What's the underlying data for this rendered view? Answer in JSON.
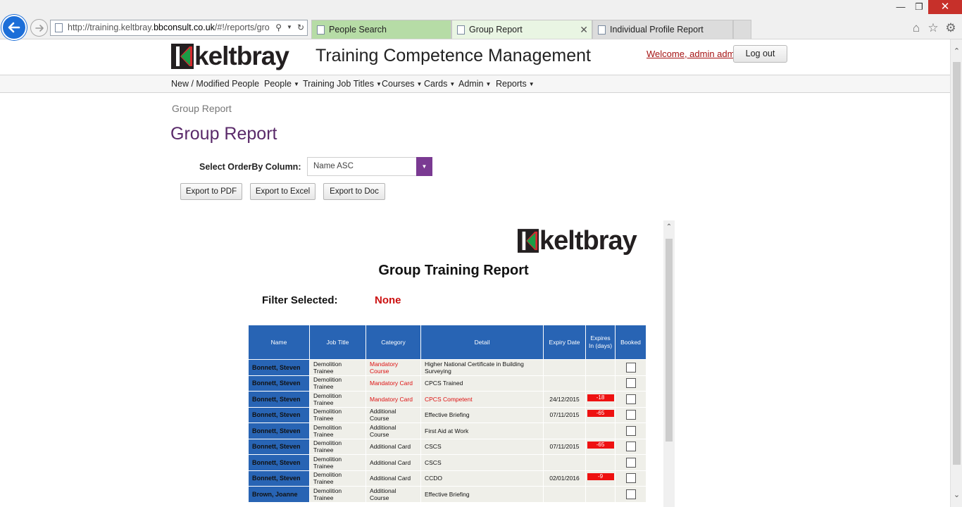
{
  "browser": {
    "url_prefix": "http://training.keltbray.",
    "url_domain": "bbconsult.co.uk",
    "url_suffix": "/#!/reports/gro",
    "tabs": [
      {
        "label": "People Search"
      },
      {
        "label": "Group Report"
      },
      {
        "label": "Individual Profile Report"
      }
    ]
  },
  "header": {
    "logo_text": "keltbray",
    "app_title": "Training Competence Management",
    "welcome": "Welcome, admin admin",
    "logout_label": "Log out"
  },
  "nav": [
    {
      "label": "New / Modified People",
      "dropdown": false
    },
    {
      "label": "People",
      "dropdown": true
    },
    {
      "label": "Training Job Titles",
      "dropdown": true
    },
    {
      "label": "Courses",
      "dropdown": true
    },
    {
      "label": "Cards",
      "dropdown": true
    },
    {
      "label": "Admin",
      "dropdown": true
    },
    {
      "label": "Reports",
      "dropdown": true
    }
  ],
  "breadcrumb": "Group Report",
  "page_title": "Group Report",
  "order_by": {
    "label": "Select OrderBy Column:",
    "value": "Name ASC"
  },
  "exports": {
    "pdf": "Export to PDF",
    "excel": "Export to Excel",
    "doc": "Export to Doc"
  },
  "colors": {
    "accent": "#7a3a92",
    "table_header": "#2864b4",
    "alert_red": "#ee1111"
  },
  "report": {
    "logo_text": "keltbray",
    "title": "Group Training Report",
    "filter_label": "Filter Selected:",
    "filter_value": "None",
    "columns": [
      "Name",
      "Job Title",
      "Category",
      "Detail",
      "Expiry Date",
      "Expires In (days)",
      "Booked"
    ],
    "rows": [
      {
        "name": "Bonnett, Steven",
        "job": "Demolition Trainee",
        "category": "Mandatory Course",
        "category_red": true,
        "detail": "Higher National Certificate in Building Surveying",
        "detail_red": false,
        "expiry": "",
        "expires_in": "",
        "booked": false
      },
      {
        "name": "Bonnett, Steven",
        "job": "Demolition Trainee",
        "category": "Mandatory Card",
        "category_red": true,
        "detail": "CPCS Trained",
        "detail_red": false,
        "expiry": "",
        "expires_in": "",
        "booked": false
      },
      {
        "name": "Bonnett, Steven",
        "job": "Demolition Trainee",
        "category": "Mandatory Card",
        "category_red": true,
        "detail": "CPCS Competent",
        "detail_red": true,
        "expiry": "24/12/2015",
        "expires_in": "-18",
        "booked": false
      },
      {
        "name": "Bonnett, Steven",
        "job": "Demolition Trainee",
        "category": "Additional Course",
        "category_red": false,
        "detail": "Effective Briefing",
        "detail_red": false,
        "expiry": "07/11/2015",
        "expires_in": "-65",
        "booked": false
      },
      {
        "name": "Bonnett, Steven",
        "job": "Demolition Trainee",
        "category": "Additional Course",
        "category_red": false,
        "detail": "First Aid at Work",
        "detail_red": false,
        "expiry": "",
        "expires_in": "",
        "booked": false
      },
      {
        "name": "Bonnett, Steven",
        "job": "Demolition Trainee",
        "category": "Additional Card",
        "category_red": false,
        "detail": "CSCS",
        "detail_red": false,
        "expiry": "07/11/2015",
        "expires_in": "-65",
        "booked": false
      },
      {
        "name": "Bonnett, Steven",
        "job": "Demolition Trainee",
        "category": "Additional Card",
        "category_red": false,
        "detail": "CSCS",
        "detail_red": false,
        "expiry": "",
        "expires_in": "",
        "booked": false
      },
      {
        "name": "Bonnett, Steven",
        "job": "Demolition Trainee",
        "category": "Additional Card",
        "category_red": false,
        "detail": "CCDO",
        "detail_red": false,
        "expiry": "02/01/2016",
        "expires_in": "-9",
        "booked": false
      },
      {
        "name": "Brown, Joanne",
        "job": "Demolition Trainee",
        "category": "Additional Course",
        "category_red": false,
        "detail": "Effective Briefing",
        "detail_red": false,
        "expiry": "",
        "expires_in": "",
        "booked": false
      }
    ]
  }
}
